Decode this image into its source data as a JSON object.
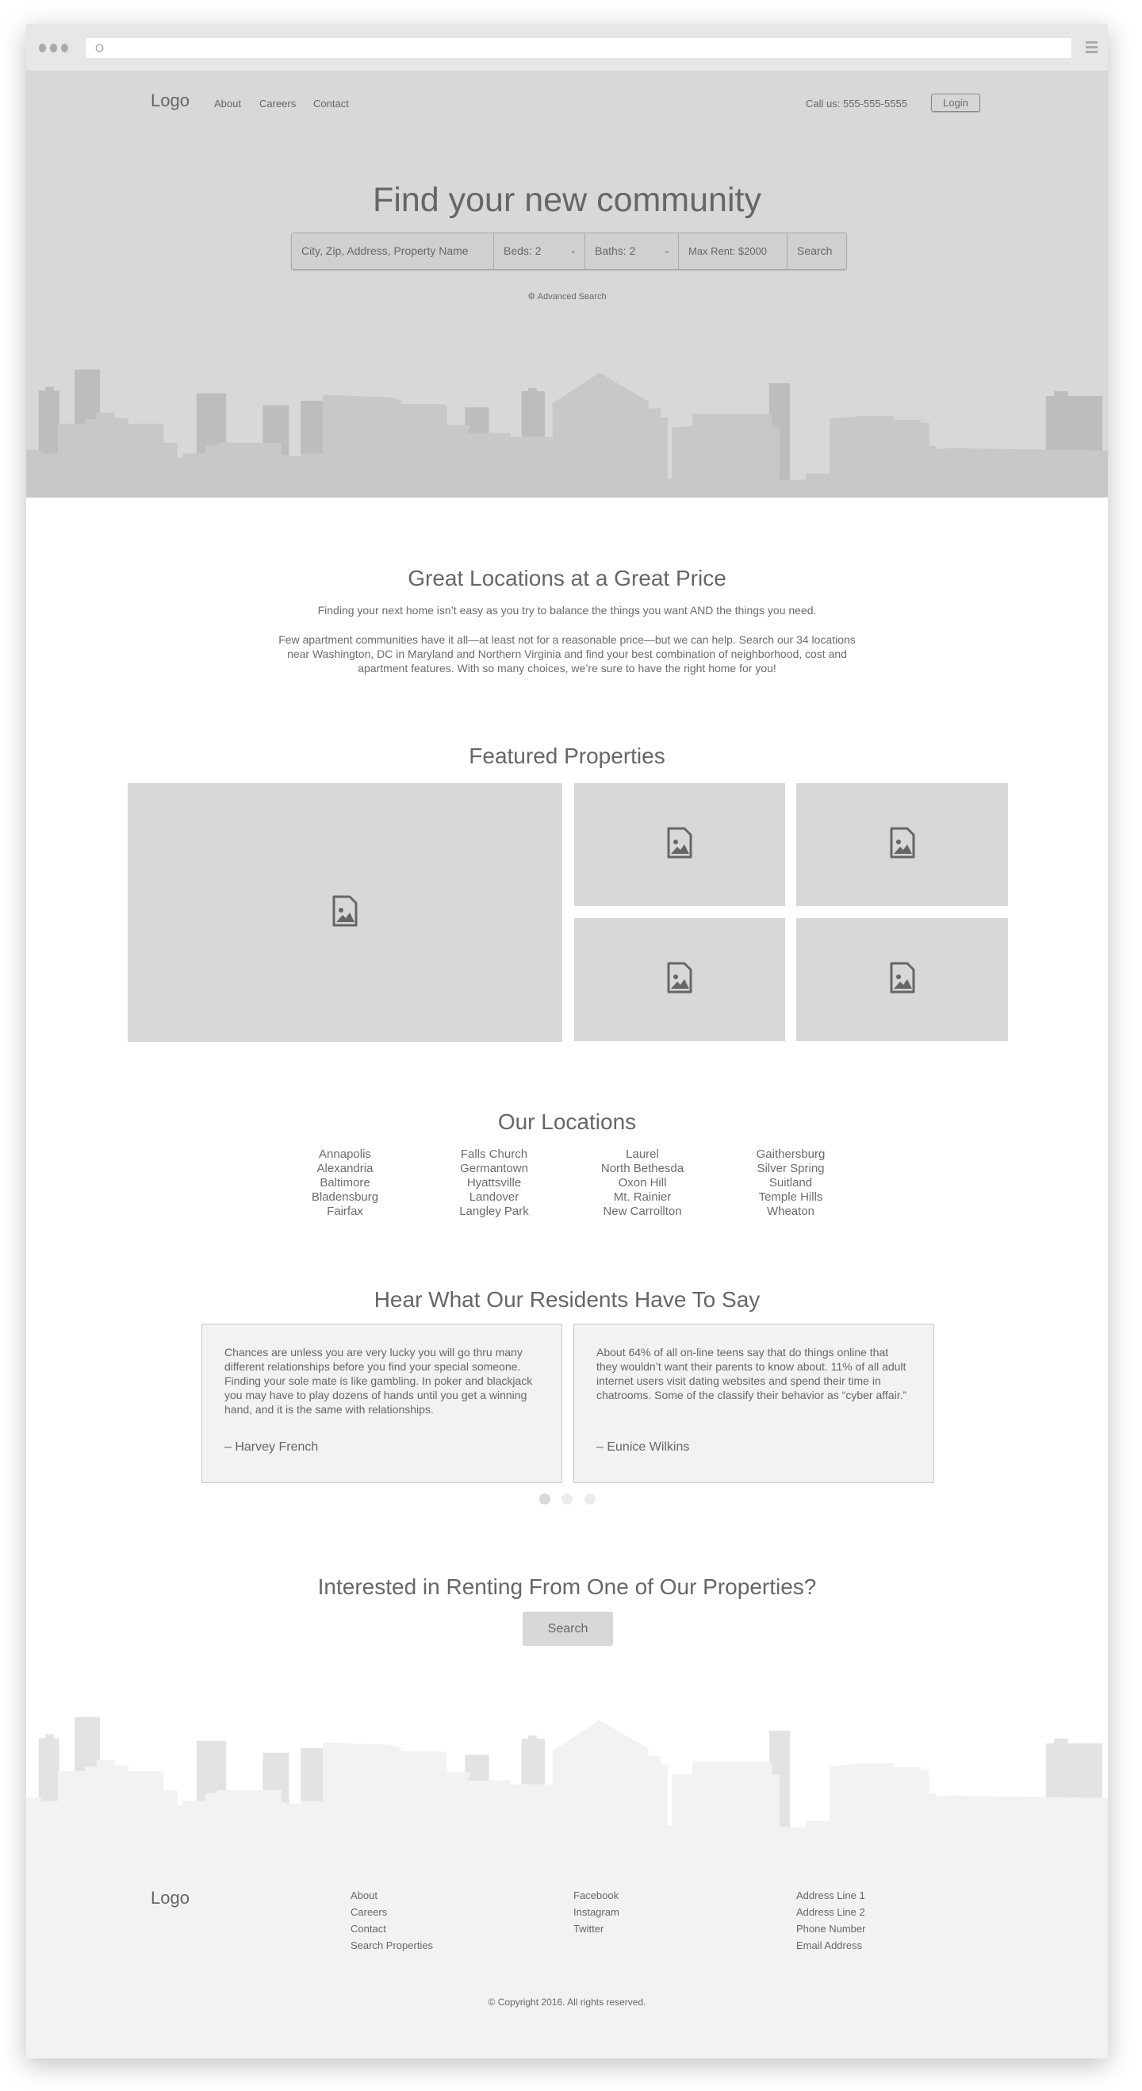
{
  "colors": {
    "hero_bg": "#d8d8d8",
    "footer_bg": "#f2f2f2",
    "text": "#666666",
    "skyline_dark": "#bdbdbd",
    "skyline_light": "#c8c8c8"
  },
  "header": {
    "logo": "Logo",
    "nav": [
      "About",
      "Careers",
      "Contact"
    ],
    "phone": "Call us: 555-555-5555",
    "login": "Login"
  },
  "hero": {
    "title": "Find your new community",
    "search": {
      "placeholder": "City, Zip, Address, Property Name",
      "beds": "Beds:  2",
      "baths": "Baths:  2",
      "max_rent": "Max Rent: $2000",
      "button": "Search"
    },
    "advanced": "Advanced Search"
  },
  "intro": {
    "title": "Great Locations at a Great Price",
    "p1": "Finding your next home isn’t easy as you try to balance the things you want AND the things you need.",
    "p2": "Few apartment communities have it all—at least not for a reasonable price—but we can help. Search our 34 locations near Washington, DC in Maryland and Northern Virginia and find your best combination of neighborhood, cost and apartment features. With so many choices, we’re sure to have the right home for you!"
  },
  "featured": {
    "title": "Featured Properties",
    "icon": "image-file-icon"
  },
  "locations": {
    "title": "Our Locations",
    "columns": [
      [
        "Annapolis",
        "Alexandria",
        "Baltimore",
        "Bladensburg",
        "Fairfax"
      ],
      [
        "Falls Church",
        "Germantown",
        "Hyattsville",
        "Landover",
        "Langley Park"
      ],
      [
        "Laurel",
        "North Bethesda",
        "Oxon Hill",
        "Mt. Rainier",
        "New Carrollton"
      ],
      [
        "Gaithersburg",
        "Silver Spring",
        "Suitland",
        "Temple Hills",
        "Wheaton"
      ]
    ]
  },
  "testimonials": {
    "title": "Hear What Our Residents Have To Say",
    "items": [
      {
        "text": "Chances are unless you are very lucky you will go thru many different relationships before you find your special someone. Finding your sole mate is like gambling. In poker and blackjack you may have to play dozens of hands until you get a winning hand, and it is the same with relationships.",
        "author": "– Harvey French"
      },
      {
        "text": "About 64% of all on-line teens say that do things online that they wouldn’t want their parents to know about. 11% of all adult internet users visit dating websites and spend their time in chatrooms. Some of the classify their behavior as “cyber affair.”",
        "author": "– Eunice Wilkins"
      }
    ],
    "active_slide": 1,
    "slide_count": 3
  },
  "cta": {
    "title": "Interested in Renting From One of Our Properties?",
    "button": "Search"
  },
  "footer": {
    "logo": "Logo",
    "col1": [
      "About",
      "Careers",
      "Contact",
      "Search Properties"
    ],
    "col2": [
      "Facebook",
      "Instagram",
      "Twitter"
    ],
    "col3": [
      "Address Line 1",
      "Address Line 2",
      "Phone Number",
      "Email Address"
    ],
    "copyright": "© Copyright 2016. All rights reserved."
  }
}
